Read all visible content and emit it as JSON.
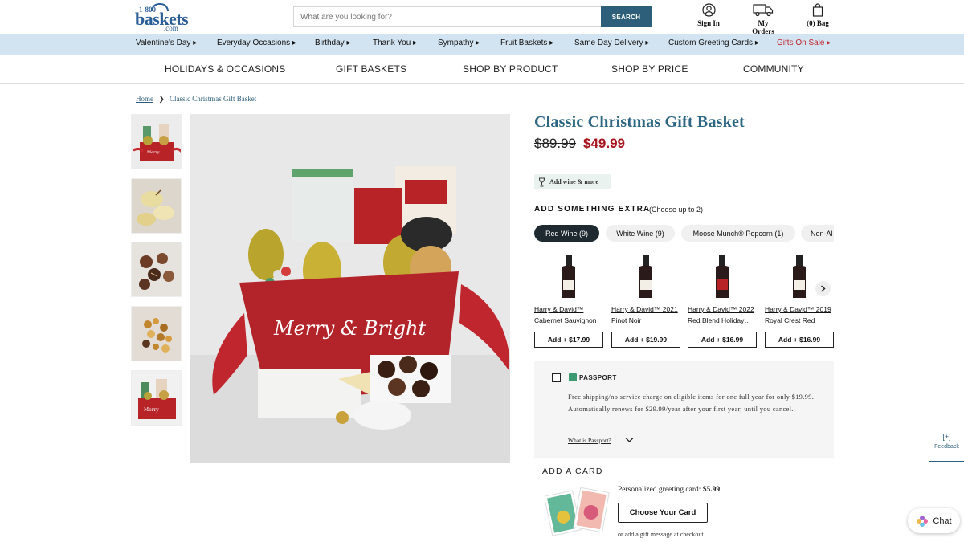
{
  "header": {
    "logo": {
      "line1": "1-800",
      "line2": "baskets",
      "line3": ".com"
    },
    "search": {
      "placeholder": "What are you looking for?",
      "button_label": "SEARCH"
    },
    "links": {
      "sign_in": "Sign In",
      "my_orders": "My Orders",
      "bag": "(0) Bag"
    }
  },
  "category_bar": [
    {
      "label": "Valentine's Day ▸"
    },
    {
      "label": "Everyday Occasions ▸"
    },
    {
      "label": "Birthday ▸"
    },
    {
      "label": "Thank You ▸"
    },
    {
      "label": "Sympathy ▸"
    },
    {
      "label": "Fruit Baskets ▸"
    },
    {
      "label": "Same Day Delivery ▸"
    },
    {
      "label": "Custom Greeting Cards ▸"
    },
    {
      "label": "Gifts On Sale ▸",
      "highlight_color": "#c0262d"
    }
  ],
  "main_nav": [
    "HOLIDAYS & OCCASIONS",
    "GIFT BASKETS",
    "SHOP BY PRODUCT",
    "SHOP BY PRICE",
    "COMMUNITY"
  ],
  "breadcrumb": {
    "home": "Home",
    "separator": "❯",
    "current": "Classic Christmas Gift Basket"
  },
  "product": {
    "title": "Classic Christmas Gift Basket",
    "old_price": "$89.99",
    "new_price": "$49.99",
    "basket_text": "Merry & Bright",
    "wine_button": "Add wine & more"
  },
  "extras": {
    "heading": "ADD SOMETHING EXTRA",
    "subheading": "(Choose up to 2)",
    "tabs": [
      {
        "label": "Red Wine (9)",
        "active": true
      },
      {
        "label": "White Wine (9)",
        "active": false
      },
      {
        "label": "Moose Munch® Popcorn (1)",
        "active": false
      },
      {
        "label": "Non-Al",
        "active": false
      }
    ],
    "items": [
      {
        "line1": "Harry & David™",
        "line2": "Cabernet Sauvignon",
        "button": "Add + $17.99"
      },
      {
        "line1": "Harry & David™ 2021",
        "line2": "Pinot Noir",
        "button": "Add + $19.99"
      },
      {
        "line1": "Harry & David™ 2022",
        "line2": "Red Blend Holiday…",
        "button": "Add + $16.99"
      },
      {
        "line1": "Harry & David™ 2019",
        "line2": "Royal Crest Red",
        "button": "Add + $16.99"
      }
    ]
  },
  "passport": {
    "brand": "PASSPORT",
    "description": "Free shipping/no service charge on eligible items for one full year for only $19.99. Automatically renews for $29.99/year after your first year, until you cancel.",
    "link": "What is Passport?"
  },
  "add_card": {
    "heading": "ADD A CARD",
    "price_label": "Personalized greeting card:",
    "price": "$5.99",
    "button": "Choose Your Card",
    "note": "or add a gift message at checkout"
  },
  "feedback": {
    "plus": "[+]",
    "label": "Feedback"
  },
  "chat": {
    "label": "Chat"
  },
  "colors": {
    "brand_blue": "#2c6683",
    "sale_red": "#a8151e",
    "category_bg": "#d2e4f1",
    "search_button": "#2d5f7a"
  }
}
